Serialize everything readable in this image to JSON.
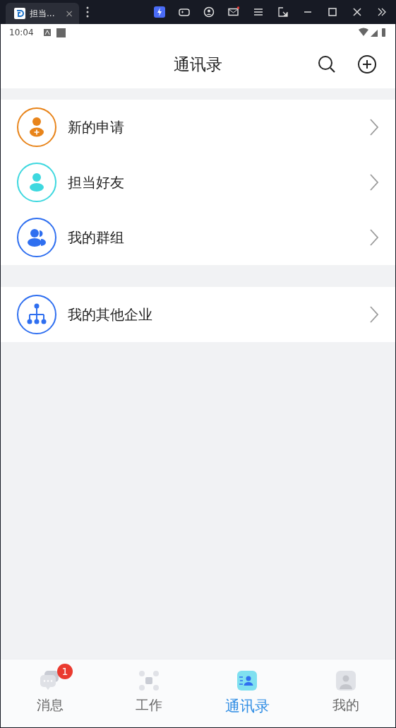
{
  "window": {
    "tab_title": "担当...",
    "close": "×"
  },
  "status_bar": {
    "time": "10:04"
  },
  "header": {
    "title": "通讯录"
  },
  "sections": [
    {
      "items": [
        {
          "kind": "request",
          "label": "新的申请",
          "color": "#e8841a"
        },
        {
          "kind": "friend",
          "label": "担当好友",
          "color": "#3ed8df"
        },
        {
          "kind": "group",
          "label": "我的群组",
          "color": "#2f6ff0"
        }
      ]
    },
    {
      "items": [
        {
          "kind": "org",
          "label": "我的其他企业",
          "color": "#2f6ff0"
        }
      ]
    }
  ],
  "tabs": [
    {
      "kind": "chat",
      "label": "消息",
      "selected": false,
      "badge": "1"
    },
    {
      "kind": "work",
      "label": "工作",
      "selected": false
    },
    {
      "kind": "contacts",
      "label": "通讯录",
      "selected": true
    },
    {
      "kind": "me",
      "label": "我的",
      "selected": false
    }
  ]
}
